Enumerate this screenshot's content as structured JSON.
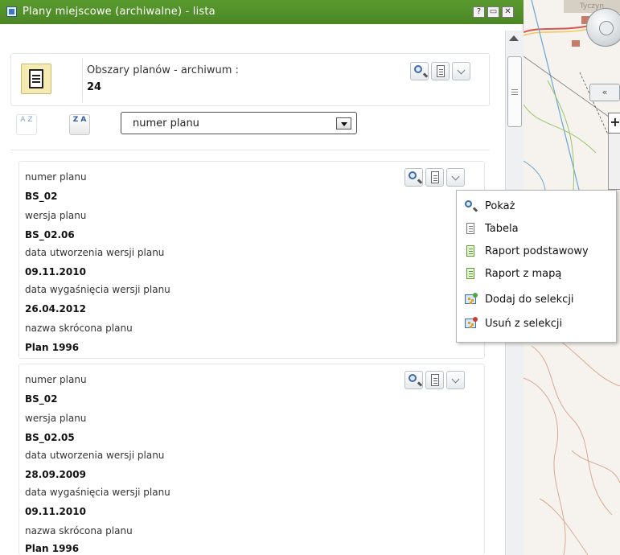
{
  "window": {
    "title": "Plany miejscowe (archiwalne) - lista",
    "help_label": "?",
    "restore_label": "▭",
    "close_label": "✕"
  },
  "summary": {
    "label": "Obszary planów - archiwum :",
    "count": "24"
  },
  "sort": {
    "asc_label": "A Z",
    "desc_label": "Z A",
    "selected_field": "numer planu"
  },
  "records": [
    {
      "numer_planu_label": "numer planu",
      "numer_planu": "BS_02",
      "wersja_label": "wersja planu",
      "wersja": "BS_02.06",
      "data_utworzenia_label": "data utworzenia wersji planu",
      "data_utworzenia": "09.11.2010",
      "data_wygasniecia_label": "data wygaśnięcia wersji planu",
      "data_wygasniecia": "26.04.2012",
      "nazwa_label": "nazwa skrócona planu",
      "nazwa": "Plan 1996"
    },
    {
      "numer_planu_label": "numer planu",
      "numer_planu": "BS_02",
      "wersja_label": "wersja planu",
      "wersja": "BS_02.05",
      "data_utworzenia_label": "data utworzenia wersji planu",
      "data_utworzenia": "28.09.2009",
      "data_wygasniecia_label": "data wygaśnięcia wersji planu",
      "data_wygasniecia": "09.11.2010",
      "nazwa_label": "nazwa skrócona planu",
      "nazwa": "Plan 1996"
    }
  ],
  "context_menu": {
    "items": [
      {
        "label": "Pokaż",
        "icon": "magnifier-icon"
      },
      {
        "label": "Tabela",
        "icon": "table-icon"
      },
      {
        "label": "Raport podstawowy",
        "icon": "report-icon"
      },
      {
        "label": "Raport z mapą",
        "icon": "map-report-icon"
      },
      {
        "label": "Dodaj do selekcji",
        "icon": "add-selection-icon"
      },
      {
        "label": "Usuń z selekcji",
        "icon": "remove-selection-icon"
      }
    ]
  },
  "map": {
    "collapse_label": "«",
    "zoom_in_label": "+",
    "badge_text": "Tyczyn"
  },
  "colors": {
    "titlebar": "#4f8b27",
    "panel_bg": "#ffffff",
    "map_bg": "#f6f3ee"
  }
}
